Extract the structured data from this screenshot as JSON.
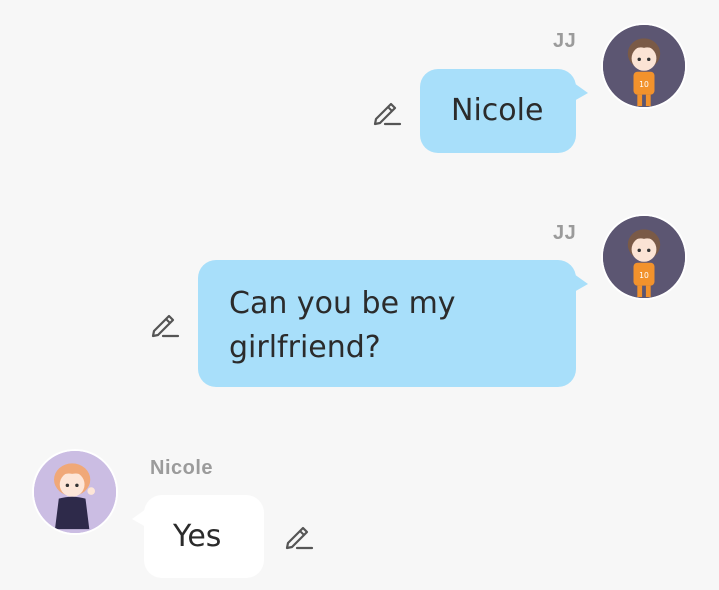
{
  "messages": [
    {
      "sender": "JJ",
      "text": "Nicole",
      "direction": "outgoing",
      "avatar": "boy-avatar"
    },
    {
      "sender": "JJ",
      "text": "Can you be my girlfriend?",
      "direction": "outgoing",
      "avatar": "boy-avatar"
    },
    {
      "sender": "Nicole",
      "text": "Yes",
      "direction": "incoming",
      "avatar": "girl-avatar"
    }
  ],
  "icons": {
    "edit": "pencil-edit-icon"
  },
  "colors": {
    "background": "#f7f7f7",
    "outgoing_bubble": "#a8dffa",
    "incoming_bubble": "#ffffff",
    "sender_name": "#9b9b9b",
    "message_text": "#2b2b2b",
    "jj_avatar_bg": "#5c5672",
    "nicole_avatar_bg": "#cbbde3"
  }
}
